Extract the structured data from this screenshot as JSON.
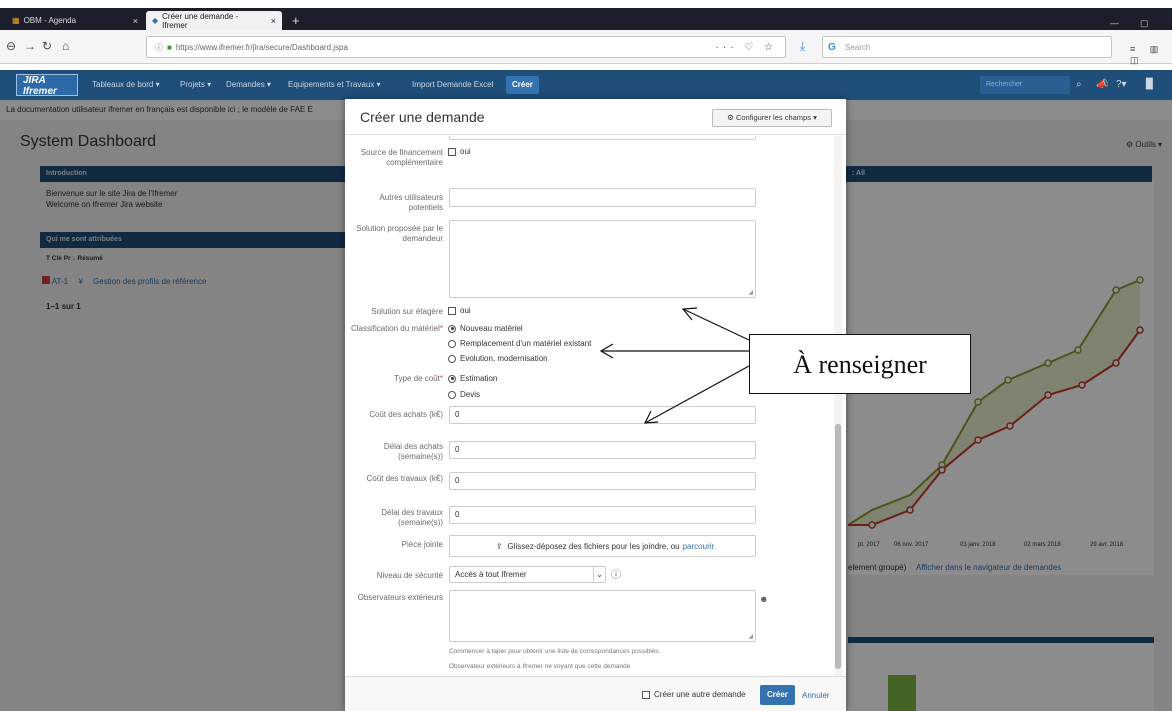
{
  "browser": {
    "tabs": [
      {
        "label": "OBM - Agenda",
        "close": "×"
      },
      {
        "label": "Créer une demande - Ifremer",
        "close": "×"
      }
    ],
    "new_tab": "+",
    "url": "https://www.ifremer.fr/jira/secure/Dashboard.jspa",
    "search_placeholder": "Search"
  },
  "jira": {
    "logo": "JIRA Ifremer",
    "menu": [
      "Tableaux de bord ▾",
      "Projets ▾",
      "Demandes ▾",
      "Equipements et Travaux ▾",
      "Import Demande Excel"
    ],
    "create_label": "Créer",
    "search_placeholder": "Rechercher"
  },
  "background": {
    "banner": "La documentation utilisateur ifremer en français est disponible ici ; le modèle de FAE E",
    "title": "System Dashboard",
    "tools": "⚙ Outils ▾",
    "intro_header": "Introduction",
    "intro_lines": [
      "Bienvenue sur le site Jira de l'Ifremer",
      "Welcome on Ifremer Jira website"
    ],
    "assigned_header": "Qui me sont attribuées",
    "assigned_cols": "T   Clé   Pr ↓   Résumé",
    "issue_key": "AT-1",
    "issue_summary": "Gestion des profils de référence",
    "pager": "1–1 sur 1",
    "chart_header": ": All",
    "x_ticks": [
      "pt. 2017",
      "06 nov. 2017",
      "03 janv. 2018",
      "02 mars 2018",
      "29 avr. 2018"
    ],
    "chart_footer_text": "element groupé)",
    "chart_footer_link": "Afficher dans le navigateur de demandes"
  },
  "modal": {
    "title": "Créer une demande",
    "configure": "⚙ Configurer les champs ▾",
    "fields": {
      "funding_label": "Source de financement complémentaire",
      "funding_option": "oui",
      "other_users_label": "Autres utilisateurs potentiels",
      "solution_label": "Solution proposée par le demandeur",
      "shelf_label": "Solution sur étagère",
      "shelf_option": "oui",
      "classification_label": "Classification du matériel",
      "classification_options": [
        "Nouveau matériel",
        "Remplacement d'un matériel existant",
        "Evolution, modernisation"
      ],
      "cost_type_label": "Type de coût",
      "cost_type_options": [
        "Estimation",
        "Devis"
      ],
      "purchase_cost_label": "Coût des achats (k€)",
      "purchase_cost_value": "0",
      "purchase_delay_label": "Délai des achats (semaine(s))",
      "purchase_delay_value": "0",
      "works_cost_label": "Coût des travaux (k€)",
      "works_cost_value": "0",
      "works_delay_label": "Délai des travaux (semaine(s))",
      "works_delay_value": "0",
      "attachment_label": "Pièce jointe",
      "attachment_text": "Glissez-déposez des fichiers pour les joindre, ou",
      "attachment_link": "parcourir",
      "security_label": "Niveau de sécurité",
      "security_value": "Accès à tout Ifremer",
      "observers_label": "Observateurs extérieurs",
      "observers_hint1": "Commencer à taper pour obtenir une liste de correspondances possibles.",
      "observers_hint2": "Observateur extérieurs à Ifremer ne voyant que cette demande"
    },
    "footer": {
      "another": "Créer une autre demande",
      "create": "Créer",
      "cancel": "Annuler"
    }
  },
  "annotation": "À renseigner",
  "colors": {
    "jira_blue": "#1f4e79",
    "button_blue": "#3572b0",
    "required": "#d04437",
    "series_olive": "#8a9a2b",
    "series_red": "#c0392b"
  }
}
